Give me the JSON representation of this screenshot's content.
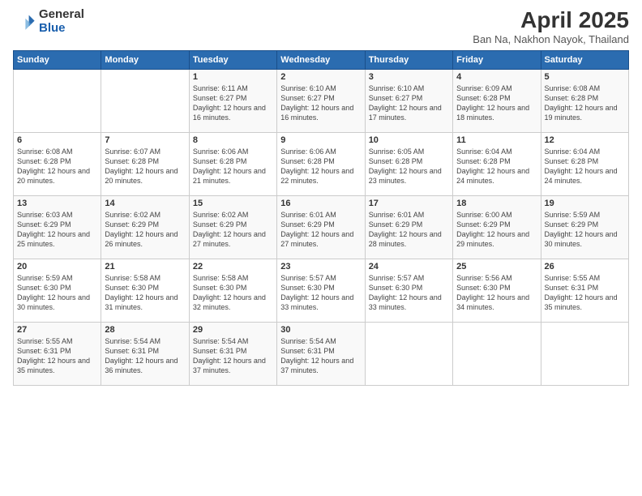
{
  "header": {
    "logo_general": "General",
    "logo_blue": "Blue",
    "title": "April 2025",
    "location": "Ban Na, Nakhon Nayok, Thailand"
  },
  "days_of_week": [
    "Sunday",
    "Monday",
    "Tuesday",
    "Wednesday",
    "Thursday",
    "Friday",
    "Saturday"
  ],
  "weeks": [
    [
      {
        "day": "",
        "info": ""
      },
      {
        "day": "",
        "info": ""
      },
      {
        "day": "1",
        "info": "Sunrise: 6:11 AM\nSunset: 6:27 PM\nDaylight: 12 hours and 16 minutes."
      },
      {
        "day": "2",
        "info": "Sunrise: 6:10 AM\nSunset: 6:27 PM\nDaylight: 12 hours and 16 minutes."
      },
      {
        "day": "3",
        "info": "Sunrise: 6:10 AM\nSunset: 6:27 PM\nDaylight: 12 hours and 17 minutes."
      },
      {
        "day": "4",
        "info": "Sunrise: 6:09 AM\nSunset: 6:28 PM\nDaylight: 12 hours and 18 minutes."
      },
      {
        "day": "5",
        "info": "Sunrise: 6:08 AM\nSunset: 6:28 PM\nDaylight: 12 hours and 19 minutes."
      }
    ],
    [
      {
        "day": "6",
        "info": "Sunrise: 6:08 AM\nSunset: 6:28 PM\nDaylight: 12 hours and 20 minutes."
      },
      {
        "day": "7",
        "info": "Sunrise: 6:07 AM\nSunset: 6:28 PM\nDaylight: 12 hours and 20 minutes."
      },
      {
        "day": "8",
        "info": "Sunrise: 6:06 AM\nSunset: 6:28 PM\nDaylight: 12 hours and 21 minutes."
      },
      {
        "day": "9",
        "info": "Sunrise: 6:06 AM\nSunset: 6:28 PM\nDaylight: 12 hours and 22 minutes."
      },
      {
        "day": "10",
        "info": "Sunrise: 6:05 AM\nSunset: 6:28 PM\nDaylight: 12 hours and 23 minutes."
      },
      {
        "day": "11",
        "info": "Sunrise: 6:04 AM\nSunset: 6:28 PM\nDaylight: 12 hours and 24 minutes."
      },
      {
        "day": "12",
        "info": "Sunrise: 6:04 AM\nSunset: 6:28 PM\nDaylight: 12 hours and 24 minutes."
      }
    ],
    [
      {
        "day": "13",
        "info": "Sunrise: 6:03 AM\nSunset: 6:29 PM\nDaylight: 12 hours and 25 minutes."
      },
      {
        "day": "14",
        "info": "Sunrise: 6:02 AM\nSunset: 6:29 PM\nDaylight: 12 hours and 26 minutes."
      },
      {
        "day": "15",
        "info": "Sunrise: 6:02 AM\nSunset: 6:29 PM\nDaylight: 12 hours and 27 minutes."
      },
      {
        "day": "16",
        "info": "Sunrise: 6:01 AM\nSunset: 6:29 PM\nDaylight: 12 hours and 27 minutes."
      },
      {
        "day": "17",
        "info": "Sunrise: 6:01 AM\nSunset: 6:29 PM\nDaylight: 12 hours and 28 minutes."
      },
      {
        "day": "18",
        "info": "Sunrise: 6:00 AM\nSunset: 6:29 PM\nDaylight: 12 hours and 29 minutes."
      },
      {
        "day": "19",
        "info": "Sunrise: 5:59 AM\nSunset: 6:29 PM\nDaylight: 12 hours and 30 minutes."
      }
    ],
    [
      {
        "day": "20",
        "info": "Sunrise: 5:59 AM\nSunset: 6:30 PM\nDaylight: 12 hours and 30 minutes."
      },
      {
        "day": "21",
        "info": "Sunrise: 5:58 AM\nSunset: 6:30 PM\nDaylight: 12 hours and 31 minutes."
      },
      {
        "day": "22",
        "info": "Sunrise: 5:58 AM\nSunset: 6:30 PM\nDaylight: 12 hours and 32 minutes."
      },
      {
        "day": "23",
        "info": "Sunrise: 5:57 AM\nSunset: 6:30 PM\nDaylight: 12 hours and 33 minutes."
      },
      {
        "day": "24",
        "info": "Sunrise: 5:57 AM\nSunset: 6:30 PM\nDaylight: 12 hours and 33 minutes."
      },
      {
        "day": "25",
        "info": "Sunrise: 5:56 AM\nSunset: 6:30 PM\nDaylight: 12 hours and 34 minutes."
      },
      {
        "day": "26",
        "info": "Sunrise: 5:55 AM\nSunset: 6:31 PM\nDaylight: 12 hours and 35 minutes."
      }
    ],
    [
      {
        "day": "27",
        "info": "Sunrise: 5:55 AM\nSunset: 6:31 PM\nDaylight: 12 hours and 35 minutes."
      },
      {
        "day": "28",
        "info": "Sunrise: 5:54 AM\nSunset: 6:31 PM\nDaylight: 12 hours and 36 minutes."
      },
      {
        "day": "29",
        "info": "Sunrise: 5:54 AM\nSunset: 6:31 PM\nDaylight: 12 hours and 37 minutes."
      },
      {
        "day": "30",
        "info": "Sunrise: 5:54 AM\nSunset: 6:31 PM\nDaylight: 12 hours and 37 minutes."
      },
      {
        "day": "",
        "info": ""
      },
      {
        "day": "",
        "info": ""
      },
      {
        "day": "",
        "info": ""
      }
    ]
  ]
}
